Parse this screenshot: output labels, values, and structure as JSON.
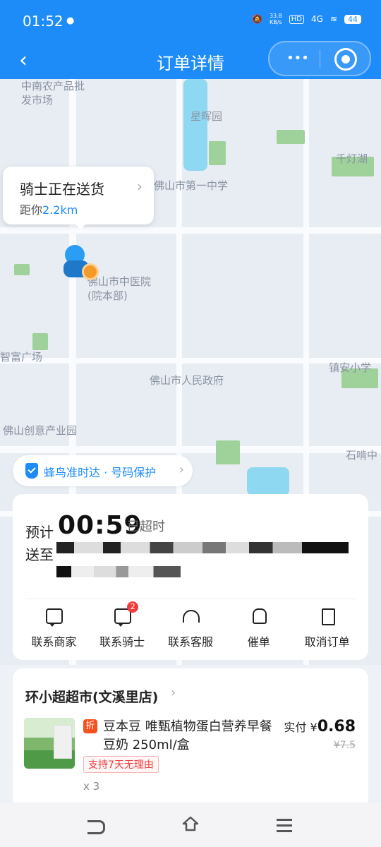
{
  "status": {
    "time": "01:52",
    "speed": "33.8\nKB/s",
    "hd": "HD",
    "signal": "4G",
    "battery": "44"
  },
  "nav": {
    "title": "订单详情"
  },
  "map": {
    "labels": [
      "中南农产品批发市场",
      "星晖园",
      "佛山市第一中学",
      "千灯湖",
      "佛山市中医院(院本部)",
      "智富广场",
      "佛山市人民政府",
      "镇安小学",
      "佛山创意产业园",
      "石啃中"
    ]
  },
  "rider_card": {
    "status": "骑士正在送货",
    "distance_prefix": "距你",
    "distance": "2.2km"
  },
  "badge": {
    "text": "蜂鸟准时达 · 号码保护"
  },
  "order": {
    "eta_label": "预计",
    "eta_time": "00:59",
    "eta_status": "已超时",
    "deliver_to_label": "送至"
  },
  "actions": [
    {
      "label": "联系商家"
    },
    {
      "label": "联系骑士",
      "badge": "2"
    },
    {
      "label": "联系客服"
    },
    {
      "label": "催单"
    },
    {
      "label": "取消订单"
    }
  ],
  "shop": {
    "name": "环小超超市(文溪里店)",
    "product_name": "豆本豆 唯甄植物蛋白营养早餐豆奶 250ml/盒",
    "discount_label": "折",
    "tag": "支持7天无理由",
    "quantity": "x 3",
    "paid_label": "实付",
    "paid_currency": "¥",
    "paid_amount": "0.68",
    "original_price": "¥7.5"
  }
}
